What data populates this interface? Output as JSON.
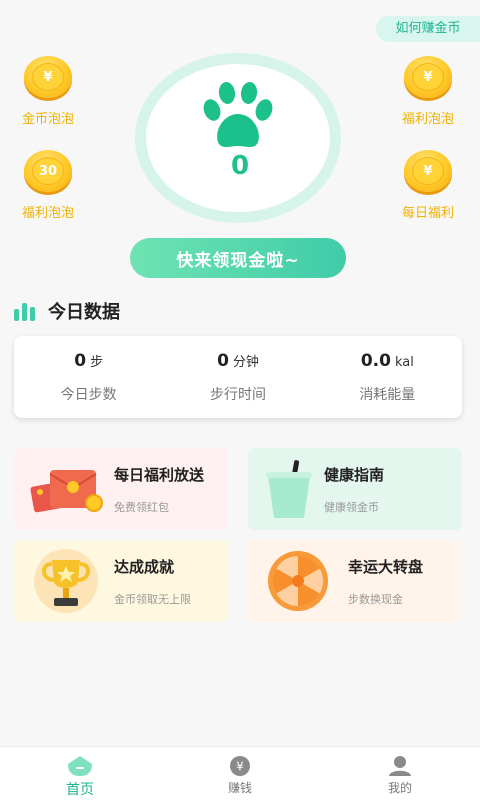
{
  "header": {
    "how_to_earn": "如何赚金币"
  },
  "bubbles": [
    {
      "label": "金币泡泡",
      "coin_text": "¥"
    },
    {
      "label": "福利泡泡",
      "coin_text": "¥"
    },
    {
      "label": "福利泡泡",
      "coin_text": "30"
    },
    {
      "label": "每日福利",
      "coin_text": "¥"
    }
  ],
  "pedometer": {
    "steps": "0",
    "claim_button": "快来领现金啦~"
  },
  "today": {
    "title": "今日数据",
    "stats": [
      {
        "value": "0",
        "unit": "步",
        "label": "今日步数"
      },
      {
        "value": "0",
        "unit": "分钟",
        "label": "步行时间"
      },
      {
        "value": "0.0",
        "unit": "kal",
        "label": "消耗能量"
      }
    ]
  },
  "cards": [
    {
      "title": "每日福利放送",
      "subtitle": "免费领红包"
    },
    {
      "title": "健康指南",
      "subtitle": "健康领金币"
    },
    {
      "title": "达成成就",
      "subtitle": "金币领取无上限"
    },
    {
      "title": "幸运大转盘",
      "subtitle": "步数换现金"
    }
  ],
  "tabs": [
    {
      "label": "首页",
      "icon": "home-icon",
      "active": true
    },
    {
      "label": "赚钱",
      "icon": "yuan-coin-icon",
      "active": false
    },
    {
      "label": "我的",
      "icon": "user-icon",
      "active": false
    }
  ],
  "colors": {
    "accent": "#3fcca8",
    "coin": "#ffc928",
    "coin_label": "#f0b200"
  }
}
